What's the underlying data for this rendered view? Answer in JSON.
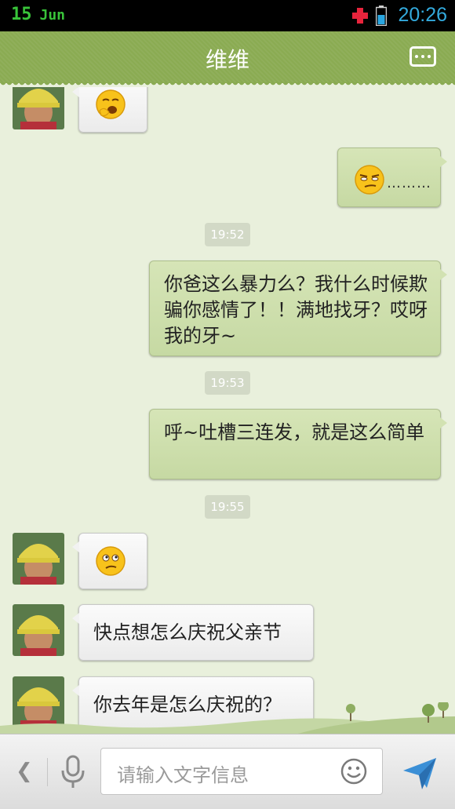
{
  "status_bar": {
    "day": "15",
    "month": "Jun",
    "time": "20:26"
  },
  "header": {
    "title": "维维",
    "more_icon": "more-options-icon"
  },
  "messages": [
    {
      "side": "in",
      "type": "emoji",
      "icon": "yawn-emoji-icon"
    },
    {
      "side": "out",
      "type": "emoji",
      "icon": "smug-emoji-icon",
      "text": "………"
    },
    {
      "type": "time",
      "text": "19:52"
    },
    {
      "side": "out",
      "type": "text",
      "text": "你爸这么暴力么？我什么时候欺骗你感情了！！满地找牙？哎呀我的牙~"
    },
    {
      "type": "time",
      "text": "19:53"
    },
    {
      "side": "out",
      "type": "text",
      "text": "呼~吐槽三连发，就是这么简单"
    },
    {
      "type": "time",
      "text": "19:55"
    },
    {
      "side": "in",
      "type": "emoji",
      "icon": "confused-emoji-icon"
    },
    {
      "side": "in",
      "type": "text",
      "text": "快点想怎么庆祝父亲节"
    },
    {
      "side": "in",
      "type": "text",
      "text": "你去年是怎么庆祝的？"
    }
  ],
  "input_bar": {
    "placeholder": "请输入文字信息"
  },
  "colors": {
    "header": "#8aab52",
    "chat_bg": "#e9f0dc",
    "out_bubble": "#cfe0ae",
    "in_bubble": "#f5f5f5",
    "status_date": "#39c43a",
    "status_time": "#33aadd"
  }
}
